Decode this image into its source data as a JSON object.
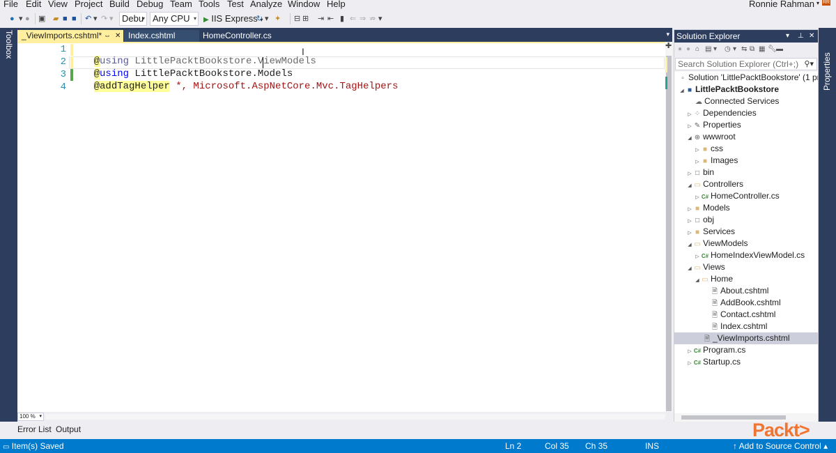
{
  "menu": {
    "items": [
      "File",
      "Edit",
      "View",
      "Project",
      "Build",
      "Debug",
      "Team",
      "Tools",
      "Test",
      "Analyze",
      "Window",
      "Help"
    ],
    "user": "Ronnie Rahman",
    "badge": "RR"
  },
  "toolbar": {
    "config": "Debu",
    "platform": "Any CPU",
    "run_target": "IIS Express"
  },
  "rails": {
    "left": "Toolbox",
    "right": "Properties"
  },
  "editor": {
    "tabs": [
      {
        "label": "_ViewImports.cshtml*",
        "active": true
      },
      {
        "label": "Index.cshtml",
        "active": false
      },
      {
        "label": "HomeController.cs",
        "active": false
      }
    ],
    "line_numbers": [
      "1",
      "2",
      "3",
      "4"
    ],
    "lines": [
      {
        "directive": "@",
        "keyword": "using",
        "rest": " LittlePacktBookstore.ViewModels"
      },
      {
        "directive": "@",
        "keyword": "using",
        "rest": " LittlePacktBookstore.Models"
      },
      {
        "directive": "@addTagHelper",
        "keyword": "",
        "rest": " *, Microsoft.AspNetCore.Mvc.TagHelpers"
      },
      {
        "directive": "",
        "keyword": "",
        "rest": ""
      }
    ],
    "zoom": "100 %"
  },
  "solution_explorer": {
    "title": "Solution Explorer",
    "search_placeholder": "Search Solution Explorer (Ctrl+;)",
    "nodes": [
      {
        "label": "Solution 'LittlePacktBookstore' (1 pr",
        "icon": "solution-icon",
        "expander": ""
      },
      {
        "label": "LittlePacktBookstore",
        "icon": "project-icon",
        "expander": "expanded"
      },
      {
        "label": "Connected Services",
        "icon": "connected-services-icon",
        "expander": ""
      },
      {
        "label": "Dependencies",
        "icon": "dependencies-icon",
        "expander": "collapsed"
      },
      {
        "label": "Properties",
        "icon": "wrench-icon",
        "expander": "collapsed"
      },
      {
        "label": "wwwroot",
        "icon": "globe-icon",
        "expander": "expanded"
      },
      {
        "label": "css",
        "icon": "folder-icon",
        "expander": "collapsed"
      },
      {
        "label": "Images",
        "icon": "folder-icon",
        "expander": "collapsed"
      },
      {
        "label": "bin",
        "icon": "folder-outline-icon",
        "expander": "collapsed"
      },
      {
        "label": "Controllers",
        "icon": "folder-open-icon",
        "expander": "expanded"
      },
      {
        "label": "HomeController.cs",
        "icon": "csharp-file-icon",
        "expander": "collapsed"
      },
      {
        "label": "Models",
        "icon": "folder-icon",
        "expander": "collapsed"
      },
      {
        "label": "obj",
        "icon": "folder-outline-icon",
        "expander": "collapsed"
      },
      {
        "label": "Services",
        "icon": "folder-icon",
        "expander": "collapsed"
      },
      {
        "label": "ViewModels",
        "icon": "folder-open-icon",
        "expander": "expanded"
      },
      {
        "label": "HomeIndexViewModel.cs",
        "icon": "csharp-file-icon",
        "expander": "collapsed"
      },
      {
        "label": "Views",
        "icon": "folder-open-icon",
        "expander": "expanded"
      },
      {
        "label": "Home",
        "icon": "folder-open-icon",
        "expander": "expanded"
      },
      {
        "label": "About.cshtml",
        "icon": "razor-file-icon",
        "expander": ""
      },
      {
        "label": "AddBook.cshtml",
        "icon": "razor-file-icon",
        "expander": ""
      },
      {
        "label": "Contact.cshtml",
        "icon": "razor-file-icon",
        "expander": ""
      },
      {
        "label": "Index.cshtml",
        "icon": "razor-file-icon",
        "expander": ""
      },
      {
        "label": "_ViewImports.cshtml",
        "icon": "razor-file-icon",
        "expander": ""
      },
      {
        "label": "Program.cs",
        "icon": "csharp-file-icon",
        "expander": "collapsed"
      },
      {
        "label": "Startup.cs",
        "icon": "csharp-file-icon",
        "expander": "collapsed"
      }
    ]
  },
  "bottom_tabs": [
    "Error List",
    "Output"
  ],
  "status": {
    "message": "Item(s) Saved",
    "line": "Ln 2",
    "col": "Col 35",
    "ch": "Ch 35",
    "mode": "INS",
    "source_control": "Add to Source Control"
  },
  "watermark": "Packt>"
}
